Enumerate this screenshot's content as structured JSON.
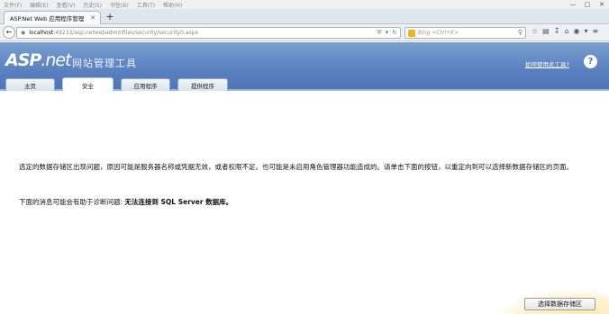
{
  "menubar": {
    "items": [
      "文件(F)",
      "编辑(E)",
      "查看(V)",
      "历史(S)",
      "书签(B)",
      "工具(T)",
      "帮助(H)"
    ]
  },
  "window_controls": [
    "minimize-icon",
    "maximize-icon",
    "close-icon"
  ],
  "browser": {
    "tab_title": "ASP.Net Web 应用程序管理",
    "new_tab": "+",
    "url_host": "localhost",
    "url_path": ":49233/asp.netwebadminfiles/security/security0.aspx",
    "search_placeholder": "Bing <Ctrl+K>"
  },
  "header": {
    "logo_asp": "ASP",
    "logo_net": ".net",
    "app_title": "网站管理工具",
    "help_link": "如何使用此工具?",
    "help_icon": "?"
  },
  "tabs": [
    {
      "label": "主页",
      "active": false
    },
    {
      "label": "安全",
      "active": true
    },
    {
      "label": "应用程序",
      "active": false
    },
    {
      "label": "提供程序",
      "active": false
    }
  ],
  "content": {
    "error_text": "选定的数据存储区出现问题，原因可能是服务器名称或凭据无效，或者权限不足。也可能是未启用角色管理器功能造成的。请单击下面的按钮，以重定向到可以选择新数据存储区的页面。",
    "diag_prefix": "下面的消息可能会有助于诊断问题: ",
    "diag_message": "无法连接到 SQL Server 数据库。"
  },
  "button": {
    "label": "选择数据存储区"
  },
  "colors": {
    "header_blue": "#5a81bf",
    "tab_border": "#8ea7c9"
  }
}
